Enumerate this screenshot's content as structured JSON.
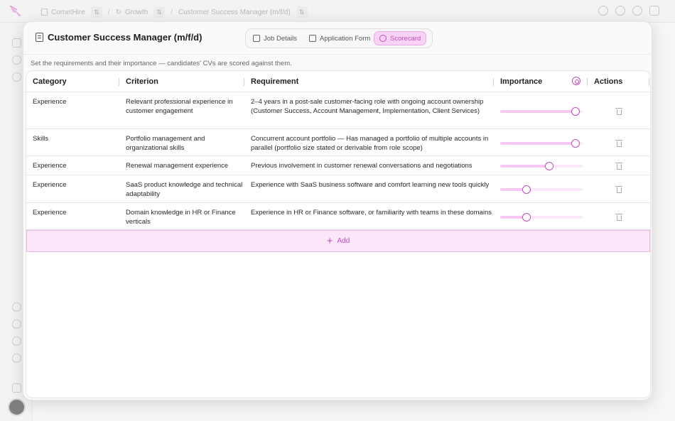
{
  "breadcrumb": {
    "workspace": "CometHire",
    "team": "Growth",
    "job": "Customer Success Manager (m/f/d)"
  },
  "modal": {
    "title": "Customer Success Manager (m/f/d)",
    "tabs": [
      {
        "label": "Job Details",
        "icon": "briefcase-icon"
      },
      {
        "label": "Application Form",
        "icon": "clipboard-icon"
      },
      {
        "label": "Scorecard",
        "icon": "check-circle-icon"
      }
    ],
    "active_tab": "Scorecard",
    "description": "Set the requirements and their importance — candidates' CVs are scored against them."
  },
  "table": {
    "headers": {
      "category": "Category",
      "criterion": "Criterion",
      "requirement": "Requirement",
      "importance": "Importance",
      "actions": "Actions"
    },
    "rows": [
      {
        "category": "Experience",
        "criterion": "Relevant professional experience in customer engagement",
        "requirement": "2–4 years in a post-sale customer-facing role with ongoing account ownership (Customer Success, Account Management, Implementation, Client Services)",
        "importance": 1.0
      },
      {
        "category": "Skills",
        "criterion": "Portfolio management and organizational skills",
        "requirement": "Concurrent account portfolio — Has managed a portfolio of multiple accounts in parallel (portfolio size stated or derivable from role scope)",
        "importance": 1.0
      },
      {
        "category": "Experience",
        "criterion": "Renewal management experience",
        "requirement": "Previous involvement in customer renewal conversations and negotiations",
        "importance": 0.65
      },
      {
        "category": "Experience",
        "criterion": "SaaS product knowledge and technical adaptability",
        "requirement": "Experience with SaaS business software and comfort learning new tools quickly",
        "importance": 0.35
      },
      {
        "category": "Experience",
        "criterion": "Domain knowledge in HR or Finance verticals",
        "requirement": "Experience in HR or Finance software, or familiarity with teams in these domains",
        "importance": 0.35
      }
    ],
    "add_label": "Add"
  },
  "colors": {
    "accent": "#c24cbf",
    "accent_light": "#fbe6fa",
    "slider_fill": "#f6c8f3"
  }
}
